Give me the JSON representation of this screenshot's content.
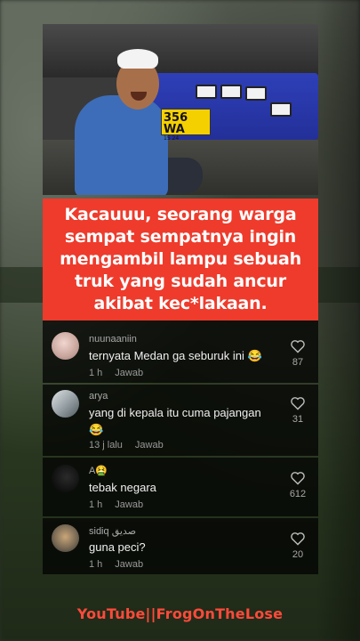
{
  "video": {
    "plate_text": "356 WA",
    "plate_sub": "15 24"
  },
  "caption": {
    "text": "Kacauuu, seorang warga sempat sempatnya ingin mengambil lampu sebuah truk yang sudah ancur akibat kec*lakaan."
  },
  "comments": [
    {
      "username": "nuunaaniin",
      "text": "ternyata Medan ga seburuk ini 😂",
      "time": "1 h",
      "reply": "Jawab",
      "likes": "87"
    },
    {
      "username": "arya",
      "text": "yang di kepala itu cuma pajangan 😂",
      "time": "13 j lalu",
      "reply": "Jawab",
      "likes": "31"
    },
    {
      "username": "A🤮",
      "text": "tebak negara",
      "time": "1 h",
      "reply": "Jawab",
      "likes": "612"
    },
    {
      "username": "sidiq صديق",
      "text": "guna peci?",
      "time": "1 h",
      "reply": "Jawab",
      "likes": "20"
    }
  ],
  "footer": {
    "watermark": "YouTube||FrogOnTheLose"
  },
  "colors": {
    "caption_bg": "#ee3b2c",
    "watermark": "#ff4a3a"
  }
}
